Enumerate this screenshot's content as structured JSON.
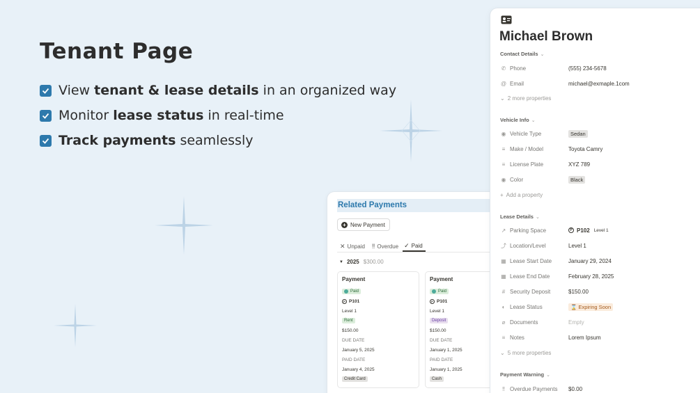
{
  "promo": {
    "title": "Tenant Page",
    "bullets": [
      {
        "pre": "View ",
        "bold": "tenant & lease details",
        "post": " in an organized way"
      },
      {
        "pre": "Monitor ",
        "bold": "lease status",
        "post": " in real-time"
      },
      {
        "pre": "",
        "bold": "Track payments",
        "post": " seamlessly"
      }
    ]
  },
  "payments": {
    "title": "Related Payments",
    "new_button": "New Payment",
    "tabs": [
      {
        "icon": "✕",
        "label": "Unpaid"
      },
      {
        "icon": "‼",
        "label": "Overdue"
      },
      {
        "icon": "✓",
        "label": "Paid"
      }
    ],
    "group": {
      "year": "2025",
      "sum": "$300.00"
    },
    "cards": [
      {
        "title": "Payment",
        "status": "Paid",
        "space": "P101",
        "level": "Level 1",
        "type": "Rent",
        "amount": "$150.00",
        "due_label": "DUE DATE",
        "due": "January 5, 2025",
        "paid_label": "PAID DATE",
        "paid": "January 4, 2025",
        "method": "Credit Card"
      },
      {
        "title": "Payment",
        "status": "Paid",
        "space": "P101",
        "level": "Level 1",
        "type": "Deposit",
        "amount": "$150.00",
        "due_label": "DUE DATE",
        "due": "January 1, 2025",
        "paid_label": "PAID DATE",
        "paid": "January 1, 2025",
        "method": "Cash"
      }
    ]
  },
  "tenant": {
    "name": "Michael Brown",
    "contact": {
      "header": "Contact Details",
      "phone_label": "Phone",
      "phone": "(555) 234-5678",
      "email_label": "Email",
      "email": "michael@exmaple.1com",
      "more": "2 more properties"
    },
    "vehicle": {
      "header": "Vehicle Info",
      "type_label": "Vehicle Type",
      "type": "Sedan",
      "model_label": "Make / Model",
      "model": "Toyota Camry",
      "plate_label": "License Plate",
      "plate": "XYZ 789",
      "color_label": "Color",
      "color": "Black",
      "add": "Add a property"
    },
    "lease": {
      "header": "Lease Details",
      "space_label": "Parking Space",
      "space": "P102",
      "space_level": "Level 1",
      "location_label": "Location/Level",
      "location": "Level 1",
      "start_label": "Lease Start Date",
      "start": "January 29, 2024",
      "end_label": "Lease End Date",
      "end": "February 28, 2025",
      "deposit_label": "Security Deposit",
      "deposit": "$150.00",
      "status_label": "Lease Status",
      "status": "Expiring Soon",
      "docs_label": "Documents",
      "docs": "Empty",
      "notes_label": "Notes",
      "notes": "Lorem Ipsum",
      "more": "5 more properties"
    },
    "warning": {
      "header": "Payment Warning",
      "overdue_label": "Overdue Payments",
      "overdue": "$0.00"
    }
  },
  "colors": {
    "accent": "#2d79ac",
    "background": "#e8f1f8"
  }
}
